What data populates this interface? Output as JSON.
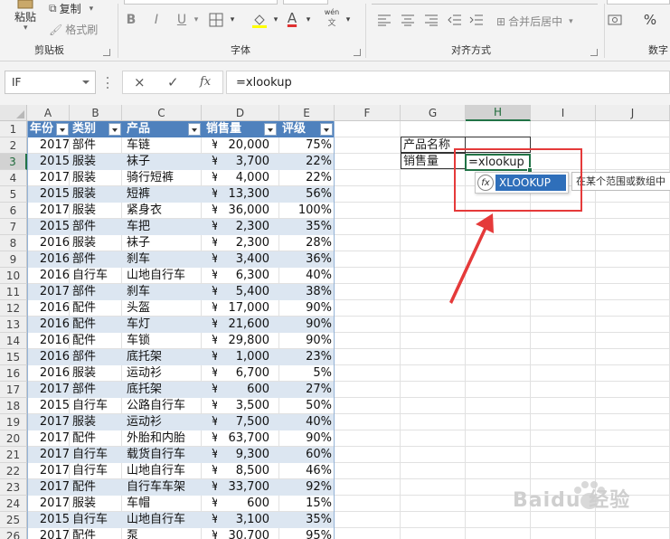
{
  "ribbon": {
    "clipboard": {
      "paste_label": "粘贴",
      "copy_label": "复制",
      "format_painter_label": "格式刷",
      "group_label": "剪贴板"
    },
    "font": {
      "group_label": "字体",
      "bold": "B",
      "italic": "I",
      "underline": "U",
      "font_color_letter": "A",
      "phonetic_label": "wén"
    },
    "alignment": {
      "group_label": "对齐方式",
      "merge_label": "合并后居中"
    },
    "number": {
      "group_label": "数字",
      "percent": "%"
    }
  },
  "formula_bar": {
    "name_box": "IF",
    "cancel_icon": "×",
    "confirm_icon": "✓",
    "fx_label": "fx",
    "formula": "=xlookup"
  },
  "columns": [
    "A",
    "B",
    "C",
    "D",
    "E",
    "F",
    "G",
    "H",
    "I",
    "J"
  ],
  "rows": [
    "1",
    "2",
    "3",
    "4",
    "5",
    "6",
    "7",
    "8",
    "9",
    "10",
    "11",
    "12",
    "13",
    "14",
    "15",
    "16",
    "17",
    "18",
    "19",
    "20",
    "21",
    "22",
    "23",
    "24",
    "25",
    "26"
  ],
  "table": {
    "headers": [
      "年份",
      "类别",
      "产品",
      "销售量",
      "评级"
    ],
    "rows": [
      {
        "year": "2017",
        "cat": "部件",
        "prod": "车链",
        "amt": "20,000",
        "pct": "75%"
      },
      {
        "year": "2015",
        "cat": "服装",
        "prod": "袜子",
        "amt": "3,700",
        "pct": "22%"
      },
      {
        "year": "2017",
        "cat": "服装",
        "prod": "骑行短裤",
        "amt": "4,000",
        "pct": "22%"
      },
      {
        "year": "2015",
        "cat": "服装",
        "prod": "短裤",
        "amt": "13,300",
        "pct": "56%"
      },
      {
        "year": "2017",
        "cat": "服装",
        "prod": "紧身衣",
        "amt": "36,000",
        "pct": "100%"
      },
      {
        "year": "2015",
        "cat": "部件",
        "prod": "车把",
        "amt": "2,300",
        "pct": "35%"
      },
      {
        "year": "2016",
        "cat": "服装",
        "prod": "袜子",
        "amt": "2,300",
        "pct": "28%"
      },
      {
        "year": "2016",
        "cat": "部件",
        "prod": "刹车",
        "amt": "3,400",
        "pct": "36%"
      },
      {
        "year": "2016",
        "cat": "自行车",
        "prod": "山地自行车",
        "amt": "6,300",
        "pct": "40%"
      },
      {
        "year": "2017",
        "cat": "部件",
        "prod": "刹车",
        "amt": "5,400",
        "pct": "38%"
      },
      {
        "year": "2016",
        "cat": "配件",
        "prod": "头盔",
        "amt": "17,000",
        "pct": "90%"
      },
      {
        "year": "2016",
        "cat": "配件",
        "prod": "车灯",
        "amt": "21,600",
        "pct": "90%"
      },
      {
        "year": "2016",
        "cat": "配件",
        "prod": "车锁",
        "amt": "29,800",
        "pct": "90%"
      },
      {
        "year": "2016",
        "cat": "部件",
        "prod": "底托架",
        "amt": "1,000",
        "pct": "23%"
      },
      {
        "year": "2016",
        "cat": "服装",
        "prod": "运动衫",
        "amt": "6,700",
        "pct": "5%"
      },
      {
        "year": "2017",
        "cat": "部件",
        "prod": "底托架",
        "amt": "600",
        "pct": "27%"
      },
      {
        "year": "2015",
        "cat": "自行车",
        "prod": "公路自行车",
        "amt": "3,500",
        "pct": "50%"
      },
      {
        "year": "2017",
        "cat": "服装",
        "prod": "运动衫",
        "amt": "7,500",
        "pct": "40%"
      },
      {
        "year": "2017",
        "cat": "配件",
        "prod": "外胎和内胎",
        "amt": "63,700",
        "pct": "90%"
      },
      {
        "year": "2017",
        "cat": "自行车",
        "prod": "载货自行车",
        "amt": "9,300",
        "pct": "60%"
      },
      {
        "year": "2017",
        "cat": "自行车",
        "prod": "山地自行车",
        "amt": "8,500",
        "pct": "46%"
      },
      {
        "year": "2017",
        "cat": "配件",
        "prod": "自行车车架",
        "amt": "33,700",
        "pct": "92%"
      },
      {
        "year": "2017",
        "cat": "服装",
        "prod": "车帽",
        "amt": "600",
        "pct": "15%"
      },
      {
        "year": "2015",
        "cat": "自行车",
        "prod": "山地自行车",
        "amt": "3,100",
        "pct": "35%"
      },
      {
        "year": "2017",
        "cat": "配件",
        "prod": "泵",
        "amt": "30,700",
        "pct": "95%"
      }
    ],
    "currency": "¥"
  },
  "lookup": {
    "product_label": "产品名称",
    "sales_label": "销售量",
    "active_cell_text": "=xlookup"
  },
  "autocomplete": {
    "item": "XLOOKUP",
    "fx_glyph": "fx",
    "tooltip": "在某个范围或数组中"
  },
  "watermark": {
    "text": "Baidu 经验"
  },
  "colors": {
    "table_header": "#4f81bd",
    "band": "#dce6f1",
    "excel_green": "#217346",
    "annotation_red": "#e53a3a",
    "autocomplete_highlight": "#2f6fba"
  }
}
